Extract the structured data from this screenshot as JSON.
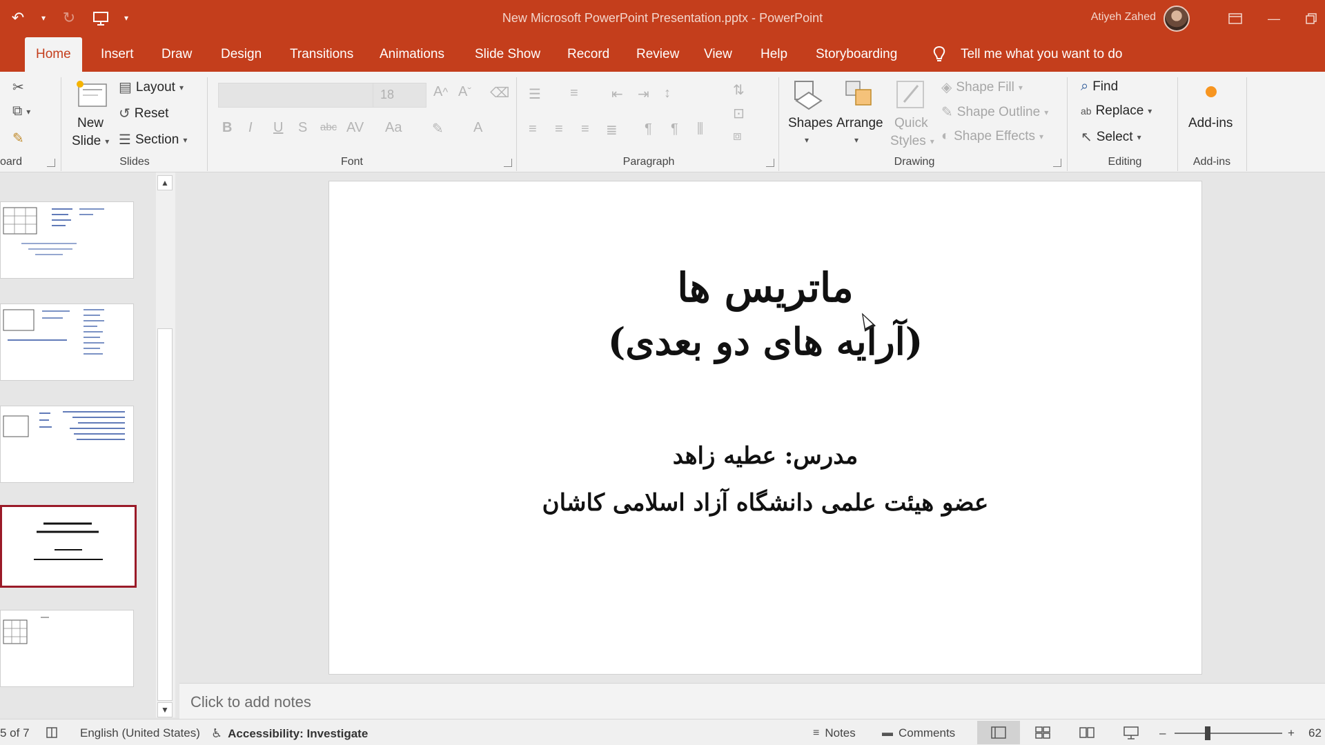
{
  "window": {
    "title": "New Microsoft PowerPoint Presentation.pptx",
    "app": "PowerPoint",
    "separator": "-",
    "user": "Atiyeh Zahed"
  },
  "tabs": [
    {
      "label": "Home",
      "active": true
    },
    {
      "label": "Insert"
    },
    {
      "label": "Draw"
    },
    {
      "label": "Design"
    },
    {
      "label": "Transitions"
    },
    {
      "label": "Animations"
    },
    {
      "label": "Slide Show"
    },
    {
      "label": "Record"
    },
    {
      "label": "Review"
    },
    {
      "label": "View"
    },
    {
      "label": "Help"
    },
    {
      "label": "Storyboarding"
    }
  ],
  "tell_me": "Tell me what you want to do",
  "ribbon": {
    "clipboard": {
      "label": "oard"
    },
    "slides": {
      "label": "Slides",
      "new_slide": "New",
      "new_slide2": "Slide",
      "layout": "Layout",
      "reset": "Reset",
      "section": "Section"
    },
    "font": {
      "label": "Font",
      "size": "18"
    },
    "paragraph": {
      "label": "Paragraph"
    },
    "drawing": {
      "label": "Drawing",
      "shapes": "Shapes",
      "arrange": "Arrange",
      "quick": "Quick",
      "styles": "Styles",
      "fill": "Shape Fill",
      "outline": "Shape Outline",
      "effects": "Shape Effects"
    },
    "editing": {
      "label": "Editing",
      "find": "Find",
      "replace": "Replace",
      "select": "Select"
    },
    "addins": {
      "label": "Add-ins",
      "btn": "Add-ins"
    }
  },
  "slide": {
    "title_line1": "ماتریس ها",
    "title_line2": "(آرایه های دو بعدی)",
    "sub_line1": "مدرس: عطیه زاهد",
    "sub_line2": "عضو هیئت علمی دانشگاه آزاد اسلامی کاشان"
  },
  "notes_placeholder": "Click to add notes",
  "status": {
    "slide_counter": "5 of 7",
    "language": "English (United States)",
    "accessibility": "Accessibility: Investigate",
    "notes": "Notes",
    "comments": "Comments",
    "zoom_minus": "–",
    "zoom_plus": "+",
    "zoom_value": "62"
  },
  "colors": {
    "accent": "#c43e1c",
    "selected_thumb": "#9a1a28"
  }
}
